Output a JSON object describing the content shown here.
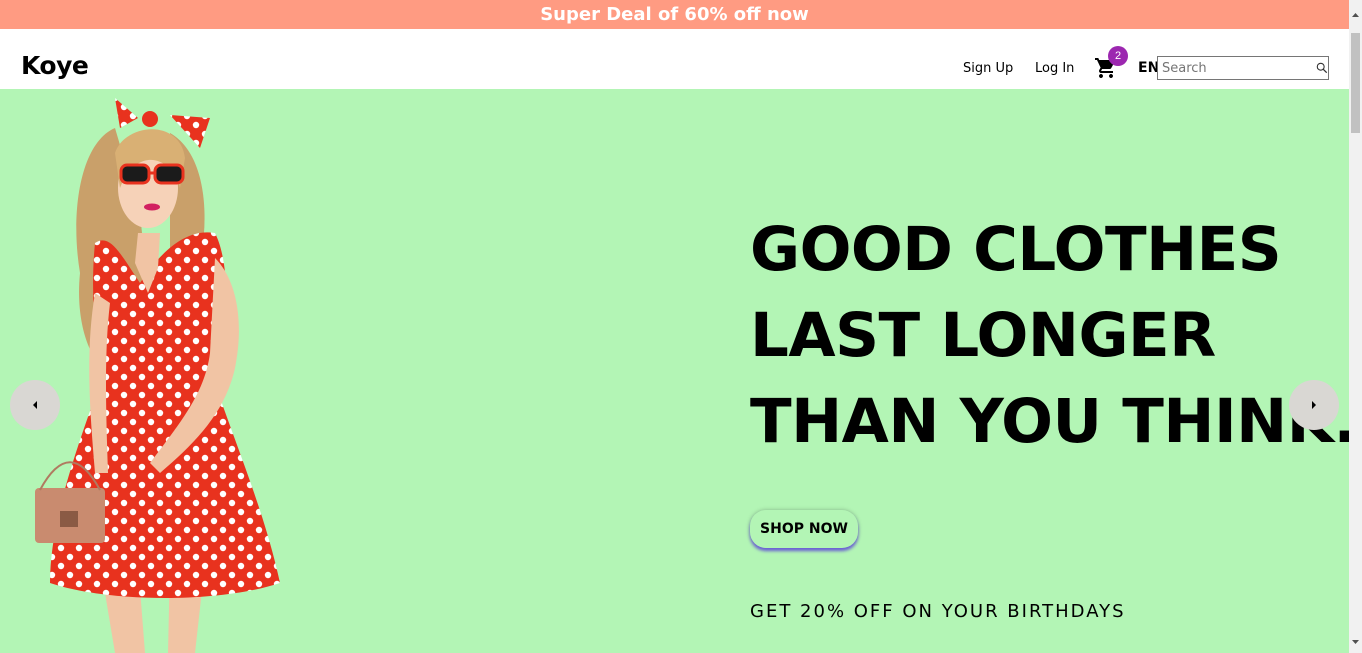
{
  "announcement": {
    "text": "Super Deal of 60% off now"
  },
  "header": {
    "logo": "Koye",
    "signup_label": "Sign Up",
    "login_label": "Log In",
    "cart_count": "2",
    "cart_icon": "cart-icon",
    "language": "EN",
    "search_placeholder": "Search",
    "search_icon": "search-icon"
  },
  "hero": {
    "headline": [
      "GOOD CLOTHES",
      "LAST LONGER",
      "THAN YOU THINK."
    ],
    "cta_label": "SHOP NOW",
    "promo": "GET 20% OFF ON YOUR BIRTHDAYS",
    "prev_icon": "chevron-left-icon",
    "next_icon": "chevron-right-icon"
  },
  "colors": {
    "announcement_bg": "#ff9b82",
    "hero_bg": "#b3f5b5",
    "badge": "#9c27b0",
    "dress": "#e8321e"
  }
}
